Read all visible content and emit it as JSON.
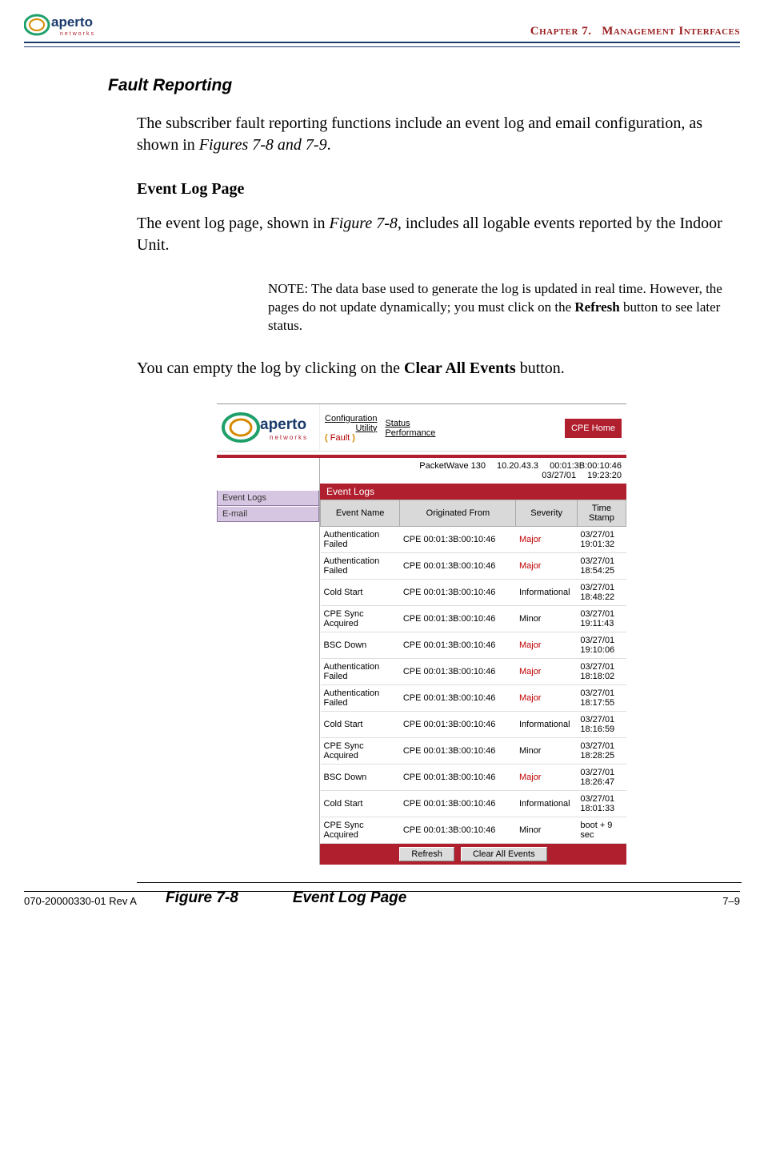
{
  "header": {
    "chapter_label": "Chapter 7.",
    "chapter_title": "Management Interfaces"
  },
  "section": {
    "fault_title": "Fault Reporting",
    "intro_a": "The subscriber fault reporting functions include an event log and email configuration, as shown in ",
    "intro_em": "Figures 7-8 and 7-9",
    "intro_b": ".",
    "event_log_heading": "Event Log Page",
    "event_log_para_a": "The event log page, shown in ",
    "event_log_para_em": "Figure 7-8",
    "event_log_para_b": ", includes all logable events reported by the Indoor Unit.",
    "note_label": "NOTE:",
    "note_body_a": "  The data base used to generate the log is updated in real time. However, the pages do not update dynamically; you must click on the ",
    "note_strong": "Refresh",
    "note_body_b": " button to see later status.",
    "clear_para_a": "You can empty the log by clicking on the ",
    "clear_strong": "Clear All Events",
    "clear_para_b": " button."
  },
  "figure": {
    "nav": {
      "config": "Configuration",
      "utility": "Utility",
      "fault": "Fault",
      "status": "Status",
      "performance": "Performance",
      "cpe_home": "CPE Home"
    },
    "device_line": "PacketWave 130  10.20.43.3  00:01:3B:00:10:46",
    "device_line2": "03/27/01  19:23:20",
    "side": {
      "event_logs": "Event Logs",
      "email": "E-mail"
    },
    "panel_title": "Event Logs",
    "columns": {
      "name": "Event Name",
      "from": "Originated From",
      "severity": "Severity",
      "time": "Time Stamp"
    },
    "rows": [
      {
        "n": "Authentication Failed",
        "f": "CPE  00:01:3B:00:10:46",
        "s": "Major",
        "sc": "major",
        "t": "03/27/01 19:01:32"
      },
      {
        "n": "Authentication Failed",
        "f": "CPE  00:01:3B:00:10:46",
        "s": "Major",
        "sc": "major",
        "t": "03/27/01 18:54:25"
      },
      {
        "n": "Cold Start",
        "f": "CPE  00:01:3B:00:10:46",
        "s": "Informational",
        "sc": "",
        "t": "03/27/01 18:48:22"
      },
      {
        "n": "CPE Sync Acquired",
        "f": "CPE  00:01:3B:00:10:46",
        "s": "Minor",
        "sc": "",
        "t": "03/27/01 19:11:43"
      },
      {
        "n": "BSC Down",
        "f": "CPE  00:01:3B:00:10:46",
        "s": "Major",
        "sc": "major",
        "t": "03/27/01 19:10:06"
      },
      {
        "n": "Authentication Failed",
        "f": "CPE  00:01:3B:00:10:46",
        "s": "Major",
        "sc": "major",
        "t": "03/27/01 18:18:02"
      },
      {
        "n": "Authentication Failed",
        "f": "CPE  00:01:3B:00:10:46",
        "s": "Major",
        "sc": "major",
        "t": "03/27/01 18:17:55"
      },
      {
        "n": "Cold Start",
        "f": "CPE  00:01:3B:00:10:46",
        "s": "Informational",
        "sc": "",
        "t": "03/27/01 18:16:59"
      },
      {
        "n": "CPE Sync Acquired",
        "f": "CPE  00:01:3B:00:10:46",
        "s": "Minor",
        "sc": "",
        "t": "03/27/01 18:28:25"
      },
      {
        "n": "BSC Down",
        "f": "CPE  00:01:3B:00:10:46",
        "s": "Major",
        "sc": "major",
        "t": "03/27/01 18:26:47"
      },
      {
        "n": "Cold Start",
        "f": "CPE  00:01:3B:00:10:46",
        "s": "Informational",
        "sc": "",
        "t": "03/27/01 18:01:33"
      },
      {
        "n": "CPE Sync Acquired",
        "f": "CPE  00:01:3B:00:10:46",
        "s": "Minor",
        "sc": "",
        "t": "boot + 9 sec"
      }
    ],
    "buttons": {
      "refresh": "Refresh",
      "clear": "Clear All Events"
    },
    "caption_a": "Figure 7-8",
    "caption_b": "Event Log Page"
  },
  "footer": {
    "left": "070-20000330-01 Rev A",
    "right": "7–9"
  }
}
